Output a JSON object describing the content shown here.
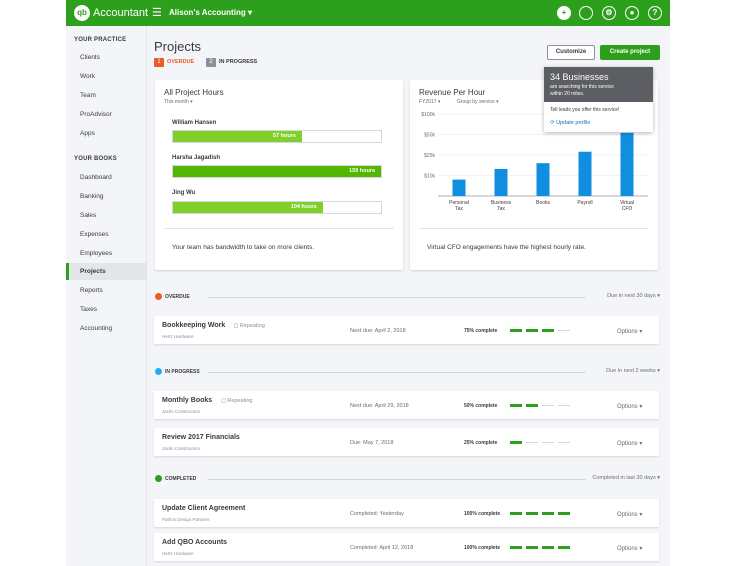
{
  "colors": {
    "brand": "#2ca01c",
    "bar_light": "#7fd12a",
    "bar_mid": "#53b700",
    "blue": "#108fe0",
    "overdue": "#ef5a24",
    "inprogress": "#21abf6"
  },
  "topbar": {
    "brand": "Accountant",
    "company": "Alison's Accounting",
    "icons": [
      "plus-icon",
      "search-icon",
      "gear-icon",
      "user-icon",
      "help-icon"
    ]
  },
  "sidebar": {
    "practice_heading": "YOUR PRACTICE",
    "practice_items": [
      "Clients",
      "Work",
      "Team",
      "ProAdvisor",
      "Apps"
    ],
    "books_heading": "YOUR BOOKS",
    "books_items": [
      "Dashboard",
      "Banking",
      "Sales",
      "Expenses",
      "Employees",
      "Projects",
      "Reports",
      "Taxes",
      "Accounting"
    ],
    "active": "Projects"
  },
  "page": {
    "title": "Projects",
    "overdue_flag": "OVERDUE",
    "overdue_count": "1",
    "inprogress_flag": "IN PROGRESS",
    "inprogress_count": "2",
    "customize": "Customize",
    "create": "Create project"
  },
  "hours_card": {
    "title": "All Project Hours",
    "period": "This month",
    "employees": [
      {
        "name": "William Hansen",
        "label": "57 hours",
        "fraction": 0.62,
        "color": "#7fd12a"
      },
      {
        "name": "Harsha Jagadish",
        "label": "159 hours",
        "fraction": 1.0,
        "color": "#53b700"
      },
      {
        "name": "Jing Wu",
        "label": "104 hours",
        "fraction": 0.72,
        "color": "#7fd12a"
      }
    ],
    "footer": "Your team has bandwidth to take on more clients."
  },
  "revenue_card": {
    "title": "Revenue Per Hour",
    "period": "FY2017",
    "group": "Group by service",
    "footer": "Virtual CFO engagements have the highest hourly rate."
  },
  "chart_data": {
    "type": "bar",
    "categories": [
      "Personal Tax",
      "Business Tax",
      "Books",
      "Payroll",
      "Virtual CFO"
    ],
    "values": [
      20,
      33,
      40,
      54,
      77
    ],
    "ytick_labels": [
      "$100k",
      "$50k",
      "$25k",
      "$10k"
    ],
    "ytick_values": [
      100,
      75,
      50,
      25
    ],
    "ylim": [
      0,
      100
    ]
  },
  "popup": {
    "count": "34 Businesses",
    "line1": "are searching for this service",
    "line2": "within 20 miles.",
    "line3": "Tell leads you offer this service!",
    "link": "Update profile"
  },
  "sections": [
    {
      "key": "overdue",
      "label": "OVERDUE",
      "filter": "Due in next 30 days",
      "rows": [
        {
          "title": "Bookkeeping Work",
          "repeating": "Repeating",
          "client": "Hertz Hardware",
          "due": "Next due: April 2, 2018",
          "pct": "75% complete",
          "progress": 0.75
        }
      ]
    },
    {
      "key": "inprogress",
      "label": "IN PROGRESS",
      "filter": "Due in next 2 weeks",
      "rows": [
        {
          "title": "Monthly Books",
          "repeating": "Repeating",
          "client": "Jaclin Construction",
          "due": "Next due: April 29, 2018",
          "pct": "50% complete",
          "progress": 0.5
        },
        {
          "title": "Review 2017 Financials",
          "repeating": "",
          "client": "Jaclin Construction",
          "due": "Due: May 7, 2018",
          "pct": "25% complete",
          "progress": 0.25
        }
      ]
    },
    {
      "key": "completed",
      "label": "COMPLETED",
      "filter": "Completed in last 30 days",
      "rows": [
        {
          "title": "Update Client Agreement",
          "repeating": "",
          "client": "Pathos Design Partners",
          "due": "Completed: Yesterday",
          "pct": "100% complete",
          "progress": 1.0
        },
        {
          "title": "Add QBO Accounts",
          "repeating": "",
          "client": "Hertz Hardware",
          "due": "Completed: April 12, 2018",
          "pct": "100% complete",
          "progress": 1.0
        }
      ]
    }
  ],
  "options_label": "Options"
}
